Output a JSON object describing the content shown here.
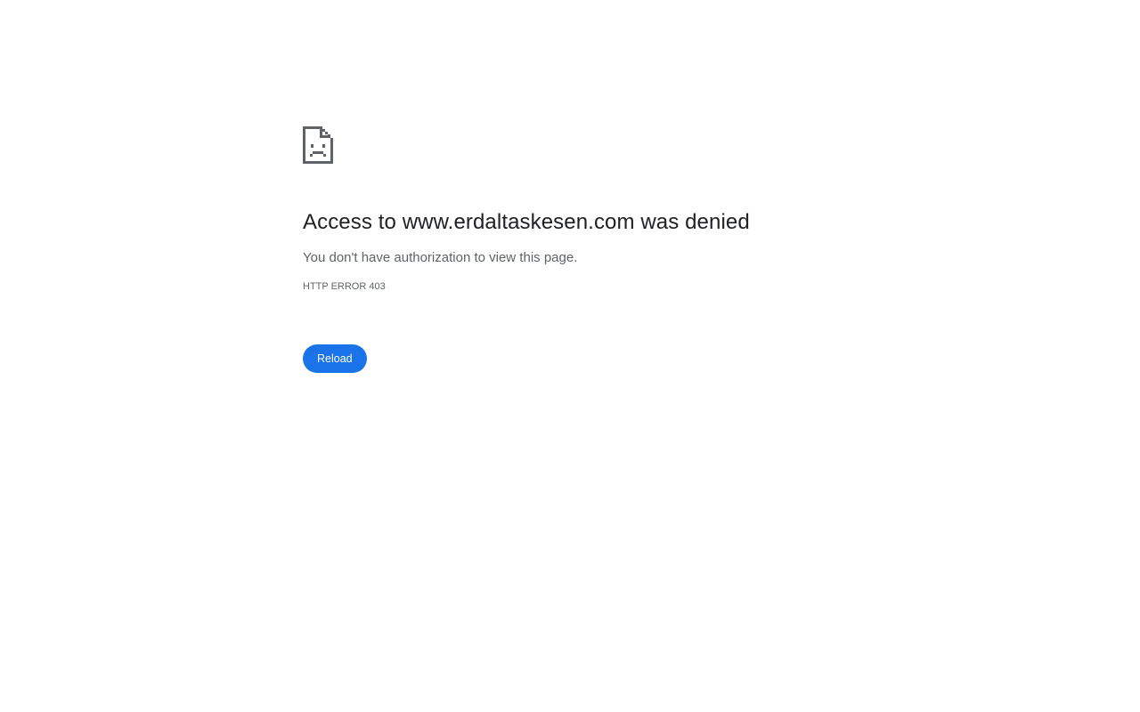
{
  "error_page": {
    "icon": "sad-page-icon",
    "heading": "Access to www.erdaltaskesen.com was denied",
    "message": "You don't have authorization to view this page.",
    "error_code": "HTTP ERROR 403",
    "reload_label": "Reload"
  },
  "colors": {
    "accent": "#1a73e8",
    "heading_text": "#202124",
    "secondary_text": "#5f6368",
    "icon": "#5f6368",
    "background": "#ffffff"
  }
}
